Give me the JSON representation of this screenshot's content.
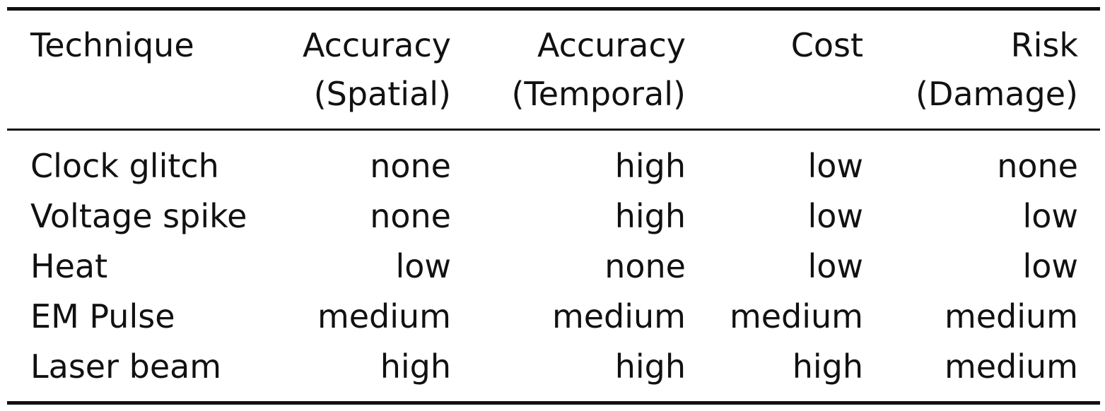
{
  "table": {
    "headers": [
      {
        "line1": "Technique",
        "line2": ""
      },
      {
        "line1": "Accuracy",
        "line2": "(Spatial)"
      },
      {
        "line1": "Accuracy",
        "line2": "(Temporal)"
      },
      {
        "line1": "Cost",
        "line2": ""
      },
      {
        "line1": "Risk",
        "line2": "(Damage)"
      }
    ],
    "rows": [
      [
        "Clock glitch",
        "none",
        "high",
        "low",
        "none"
      ],
      [
        "Voltage spike",
        "none",
        "high",
        "low",
        "low"
      ],
      [
        "Heat",
        "low",
        "none",
        "low",
        "low"
      ],
      [
        "EM Pulse",
        "medium",
        "medium",
        "medium",
        "medium"
      ],
      [
        "Laser beam",
        "high",
        "high",
        "high",
        "medium"
      ]
    ]
  }
}
